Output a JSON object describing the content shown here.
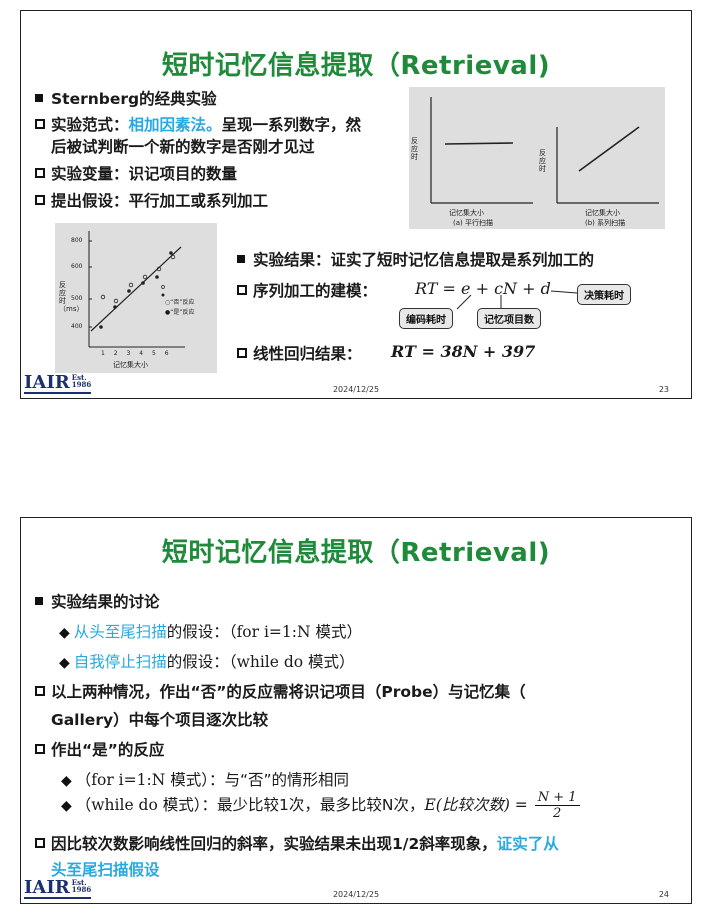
{
  "slide1": {
    "title": "短时记忆信息提取（Retrieval)",
    "line1": "Sternberg的经典实验",
    "line2a": "实验范式：",
    "line2b": "相加因素法。",
    "line2c": "呈现一系列数字，然",
    "line2d": "后被试判断一个新的数字是否刚才见过",
    "line3": "实验变量：识记项目的数量",
    "line4": "提出假设：平行加工或系列加工",
    "graph_a_xlabel": "记忆集大小",
    "graph_a_caption": "(a) 平行扫描",
    "graph_b_xlabel": "记忆集大小",
    "graph_b_caption": "(b) 系列扫描",
    "graph_ylabel": "反应时",
    "scatter": {
      "ylabel": "反应时（ms）",
      "xlabel": "记忆集大小",
      "yticks": [
        "800",
        "600",
        "500",
        "400"
      ],
      "xticks": [
        "1",
        "2",
        "3",
        "4",
        "5",
        "6"
      ],
      "legend_no": "“否”反应",
      "legend_yes": "“是”反应"
    },
    "result": "实验结果：证实了短时记忆信息提取是系列加工的",
    "model_label": "序列加工的建模：",
    "model_formula": "RT = e + cN + d",
    "callout_decision": "决策耗时",
    "callout_encode": "编码耗时",
    "callout_items": "记忆项目数",
    "regression_label": "线性回归结果：",
    "regression_formula": "RT = 38N + 397",
    "logo": "IAIR",
    "logo_est": "Est.",
    "logo_year": "1986",
    "date": "2024/12/25",
    "page": "23"
  },
  "slide2": {
    "title": "短时记忆信息提取（Retrieval)",
    "line1": "实验结果的讨论",
    "line2a": "从头至尾扫描",
    "line2b": "的假设：",
    "line2c": "（for i=1:N 模式）",
    "line3a": "自我停止扫描",
    "line3b": "的假设：",
    "line3c": "（while do 模式）",
    "line4a": "以上两种情况，作出“否”的反应需将识记项目（Probe）与记忆集（",
    "line4b": "Gallery）中每个项目逐次比较",
    "line5": "作出“是”的反应",
    "line6a": "（for i=1:N 模式）",
    "line6b": "：与“否”的情形相同",
    "line7a": "（while do 模式）",
    "line7b": "：最少比较1次，最多比较N次，",
    "line7c": "E(比较次数) =",
    "frac_num": "N + 1",
    "frac_den": "2",
    "line8a": "因比较次数影响线性回归的斜率，实验结果未出现1/2斜率现象，",
    "line8b": "证实了从",
    "line8c": "头至尾扫描假设",
    "logo": "IAIR",
    "logo_est": "Est.",
    "logo_year": "1986",
    "date": "2024/12/25",
    "page": "24"
  }
}
